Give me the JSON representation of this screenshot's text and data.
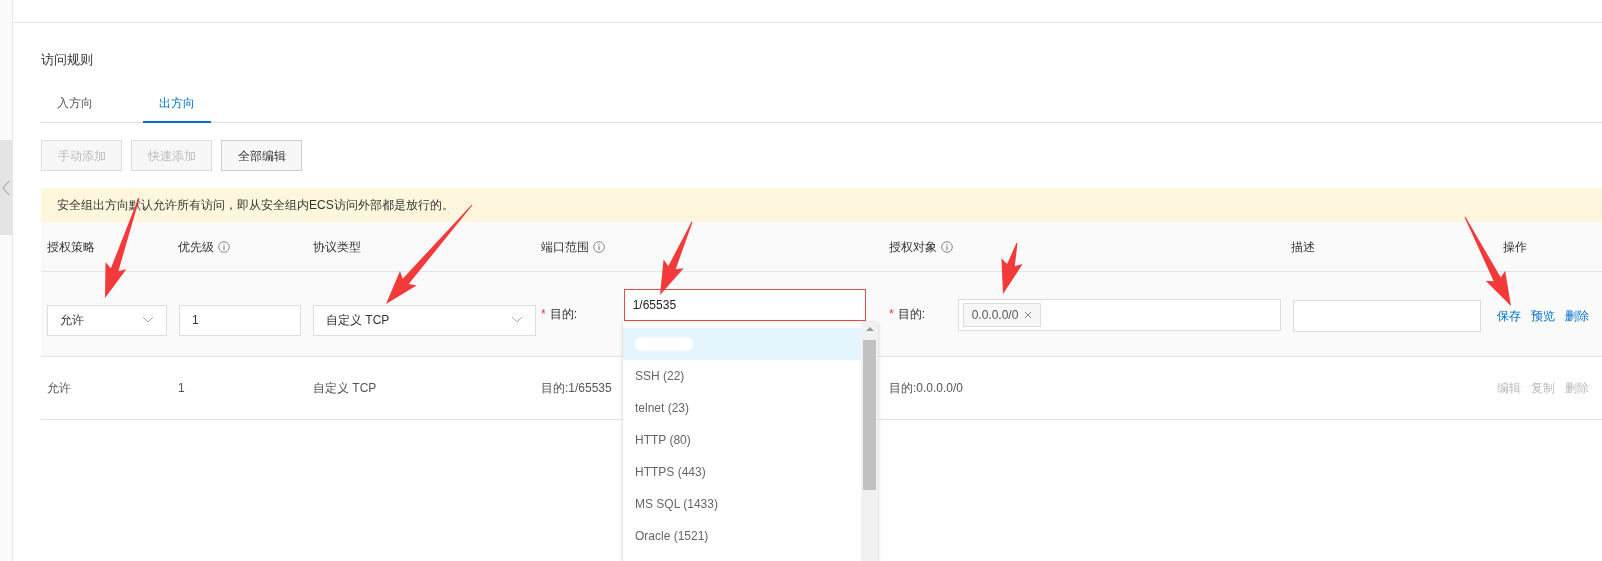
{
  "section_title": "访问规则",
  "tabs": [
    {
      "label": "入方向",
      "selected": false
    },
    {
      "label": "出方向",
      "selected": true
    }
  ],
  "toolbar": [
    {
      "label": "手动添加",
      "disabled": true
    },
    {
      "label": "快速添加",
      "disabled": true
    },
    {
      "label": "全部编辑",
      "disabled": false
    }
  ],
  "notice": "安全组出方向默认允许所有访问，即从安全组内ECS访问外部都是放行的。",
  "table": {
    "columns": [
      {
        "label": "授权策略",
        "info": false
      },
      {
        "label": "优先级",
        "info": true
      },
      {
        "label": "协议类型",
        "info": false
      },
      {
        "label": "端口范围",
        "info": true
      },
      {
        "label": "授权对象",
        "info": true
      },
      {
        "label": "描述",
        "info": false
      },
      {
        "label": "操作",
        "info": false
      }
    ],
    "edit_row": {
      "policy": "允许",
      "priority": "1",
      "protocol": "自定义 TCP",
      "port": {
        "required_mark": "*",
        "label": "目的:",
        "value": "1/65535",
        "error": true
      },
      "target": {
        "required_mark": "*",
        "label": "目的:",
        "tags": [
          "0.0.0.0/0"
        ]
      },
      "actions": [
        {
          "label": "保存",
          "disabled": false
        },
        {
          "label": "预览",
          "disabled": false
        },
        {
          "label": "删除",
          "disabled": false
        }
      ]
    },
    "rows": [
      {
        "cells": [
          "允许",
          "1",
          "自定义 TCP",
          "目的:1/65535",
          "目的:0.0.0.0/0",
          ""
        ],
        "actions": [
          {
            "label": "编辑",
            "disabled": true
          },
          {
            "label": "复制",
            "disabled": true
          },
          {
            "label": "删除",
            "disabled": true
          }
        ]
      }
    ]
  },
  "port_dropdown": {
    "items": [
      {
        "kind": "redacted",
        "selected": true
      },
      {
        "kind": "option",
        "label": "SSH (22)",
        "selected": false
      },
      {
        "kind": "option",
        "label": "telnet (23)",
        "selected": false
      },
      {
        "kind": "option",
        "label": "HTTP (80)",
        "selected": false
      },
      {
        "kind": "option",
        "label": "HTTPS (443)",
        "selected": false
      },
      {
        "kind": "option",
        "label": "MS SQL (1433)",
        "selected": false
      },
      {
        "kind": "option",
        "label": "Oracle (1521)",
        "selected": false
      }
    ]
  }
}
